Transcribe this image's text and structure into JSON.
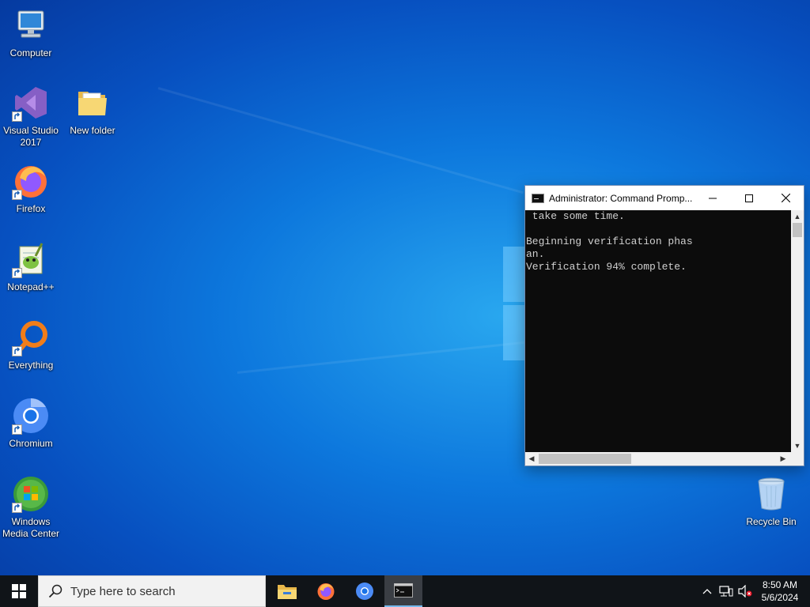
{
  "desktop": {
    "icons": [
      {
        "label": "Computer"
      },
      {
        "label": "Visual Studio 2017"
      },
      {
        "label": "New folder"
      },
      {
        "label": "Firefox"
      },
      {
        "label": "Notepad++"
      },
      {
        "label": "Everything"
      },
      {
        "label": "Chromium"
      },
      {
        "label": "Windows Media Center"
      },
      {
        "label": "Recycle Bin"
      }
    ]
  },
  "cmd_window": {
    "title": "Administrator: Command Promp...",
    "console_text": " take some time.\n\nBeginning verification phas\nan.\nVerification 94% complete.",
    "buttons": {
      "minimize": "—",
      "maximize": "☐",
      "close": "✕"
    }
  },
  "taskbar": {
    "search_placeholder": "Type here to search",
    "apps": [
      "file-explorer",
      "firefox",
      "chromium",
      "command-prompt"
    ],
    "active_app": "command-prompt",
    "clock_time": "8:50 AM",
    "clock_date": "5/6/2024"
  },
  "colors": {
    "taskbar": "#101418",
    "console_bg": "#0c0c0c",
    "accent": "#76b9ed"
  }
}
